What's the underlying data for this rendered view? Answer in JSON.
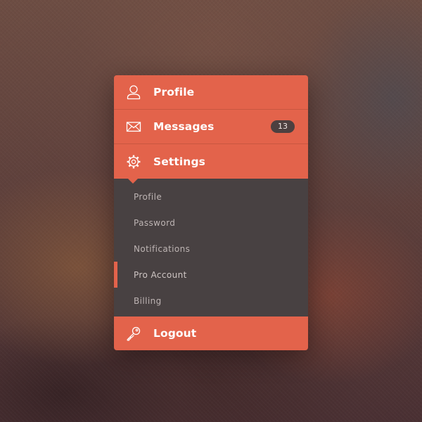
{
  "theme": {
    "accent": "#e3634b",
    "submenu_background": "#484142",
    "badge_background": "#4d4040"
  },
  "menu": {
    "items": [
      {
        "label": "Profile",
        "icon": "user-icon"
      },
      {
        "label": "Messages",
        "icon": "envelope-icon",
        "badge": "13"
      },
      {
        "label": "Settings",
        "icon": "gear-icon",
        "expanded": true
      }
    ],
    "submenu": {
      "items": [
        {
          "label": "Profile"
        },
        {
          "label": "Password"
        },
        {
          "label": "Notifications"
        },
        {
          "label": "Pro Account",
          "active": true
        },
        {
          "label": "Billing"
        }
      ]
    },
    "footer": {
      "label": "Logout",
      "icon": "key-icon"
    }
  }
}
